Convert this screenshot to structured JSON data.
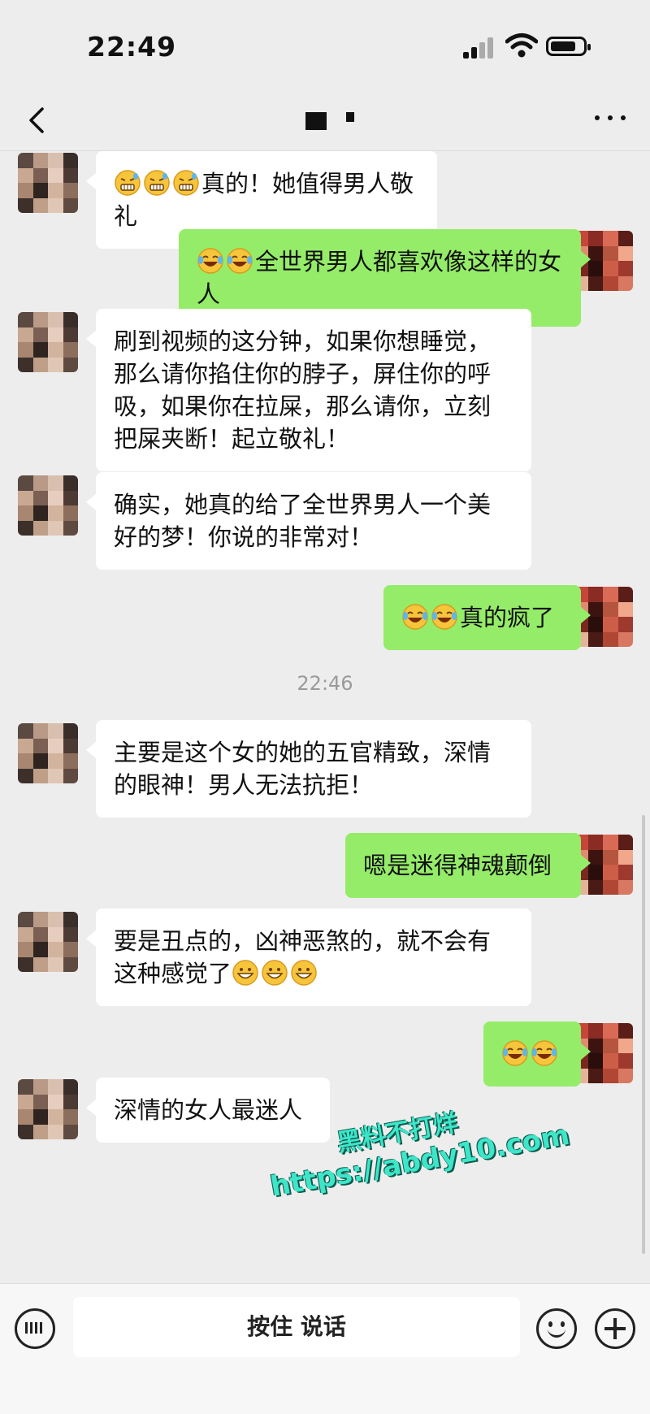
{
  "status_bar": {
    "time": "22:49"
  },
  "nav": {
    "back": "back-icon",
    "more": "more-icon"
  },
  "messages": [
    {
      "side": "in",
      "emoji": [
        "grimace-sweat",
        "grimace-sweat",
        "grimace-sweat"
      ],
      "text": "真的！她值得男人敬礼"
    },
    {
      "side": "out",
      "emoji": [
        "laugh-tears",
        "laugh-tears"
      ],
      "text": "全世界男人都喜欢像这样的女人"
    },
    {
      "side": "in",
      "text": "刷到视频的这分钟，如果你想睡觉，\n那么请你掐住你的脖子，屏住你的呼\n吸，如果你在拉屎，那么请你，立刻\n把屎夹断！起立敬礼！"
    },
    {
      "side": "in",
      "text": "确实，她真的给了全世界男人一个美\n好的梦！你说的非常对！"
    },
    {
      "side": "out",
      "emoji": [
        "laugh-tears",
        "laugh-tears"
      ],
      "text": "真的疯了"
    },
    {
      "side": "in",
      "text": "主要是这个女的她的五官精致，深情\n的眼神！男人无法抗拒！"
    },
    {
      "side": "out",
      "text": "嗯是迷得神魂颠倒"
    },
    {
      "side": "in",
      "text": "要是丑点的，凶神恶煞的，就不会有\n这种感觉了",
      "trailing_emoji": [
        "grin",
        "grin",
        "grin"
      ]
    },
    {
      "side": "out",
      "emoji": [
        "laugh-tears",
        "laugh-tears"
      ],
      "text": ""
    },
    {
      "side": "in",
      "text": "深情的女人最迷人"
    }
  ],
  "timestamp": "22:46",
  "watermark": {
    "line1": "黑料不打烊",
    "line2": "https://abdy10.com"
  },
  "input_bar": {
    "voice_label": "按住 说话",
    "keyboard": "keyboard-icon",
    "emoji": "emoji-icon",
    "plus": "plus-icon"
  },
  "colors": {
    "outgoing_bubble": "#95ec69",
    "incoming_bubble": "#ffffff",
    "background": "#ededed"
  }
}
